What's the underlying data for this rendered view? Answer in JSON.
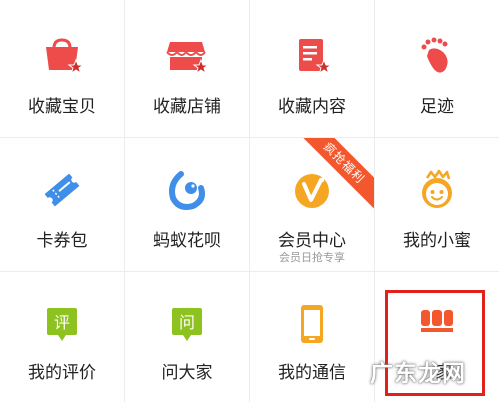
{
  "grid": {
    "items": [
      {
        "label": "收藏宝贝",
        "icon": "bag-star-icon",
        "color": "#ee4b4b"
      },
      {
        "label": "收藏店铺",
        "icon": "store-star-icon",
        "color": "#ee4b4b"
      },
      {
        "label": "收藏内容",
        "icon": "doc-star-icon",
        "color": "#ee4b4b"
      },
      {
        "label": "足迹",
        "icon": "footprint-icon",
        "color": "#ee4b4b"
      },
      {
        "label": "卡券包",
        "icon": "ticket-icon",
        "color": "#3f8ee8"
      },
      {
        "label": "蚂蚁花呗",
        "icon": "huabei-icon",
        "color": "#3f8ee8"
      },
      {
        "label": "会员中心",
        "sublabel": "会员日抢专享",
        "icon": "vip-icon",
        "color": "#f5a623",
        "ribbon": "疯抢福利"
      },
      {
        "label": "我的小蜜",
        "icon": "xiaomi-face-icon",
        "color": "#f5a623"
      },
      {
        "label": "我的评价",
        "icon": "review-bubble-icon",
        "color": "#8dc21f",
        "glyph": "评"
      },
      {
        "label": "问大家",
        "icon": "ask-bubble-icon",
        "color": "#8dc21f",
        "glyph": "问"
      },
      {
        "label": "我的通信",
        "icon": "phone-icon",
        "color": "#f5a623"
      },
      {
        "label": "家",
        "icon": "sofa-icon",
        "color": "#f2572d"
      }
    ]
  },
  "watermark": "广东龙网",
  "colors": {
    "highlight": "#e0221b",
    "ribbon": "#f2572d"
  }
}
